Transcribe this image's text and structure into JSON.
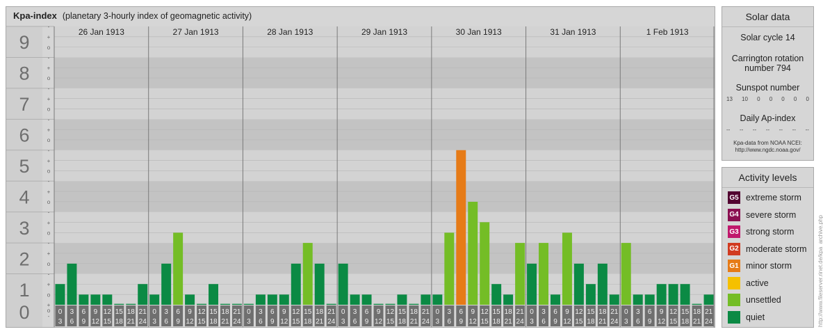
{
  "title": {
    "main": "Kpa-index",
    "sub": "(planetary 3-hourly index of geomagnetic activity)"
  },
  "chart_data": {
    "type": "bar",
    "title": "Kpa-index",
    "subtitle": "(planetary 3-hourly index of geomagnetic activity)",
    "ylim": [
      0,
      9
    ],
    "y_ticks": [
      "0",
      "1",
      "2",
      "3",
      "4",
      "5",
      "6",
      "7",
      "8",
      "9"
    ],
    "minor_marks": [
      "-",
      "o",
      "+"
    ],
    "days": [
      "26 Jan 1913",
      "27 Jan 1913",
      "28 Jan 1913",
      "29 Jan 1913",
      "30 Jan 1913",
      "31 Jan 1913",
      "1 Feb 1913"
    ],
    "interval_top": [
      "0",
      "3",
      "6",
      "9",
      "12",
      "15",
      "18",
      "21"
    ],
    "interval_bottom": [
      "3",
      "6",
      "9",
      "12",
      "15",
      "18",
      "21",
      "24"
    ],
    "values": [
      [
        0.67,
        1.33,
        0.33,
        0.33,
        0.33,
        0,
        0,
        0.67
      ],
      [
        0.33,
        1.33,
        2.33,
        0.33,
        0,
        0.67,
        0,
        0
      ],
      [
        0,
        0.33,
        0.33,
        0.33,
        1.33,
        2,
        1.33,
        0
      ],
      [
        1.33,
        0.33,
        0.33,
        0,
        0,
        0.33,
        0,
        0.33
      ],
      [
        0.33,
        2.33,
        5,
        3.33,
        2.67,
        0.67,
        0.33,
        2
      ],
      [
        1.33,
        2,
        0.33,
        2.33,
        1.33,
        0.67,
        1.33,
        0.33
      ],
      [
        2,
        0.33,
        0.33,
        0.67,
        0.67,
        0.67,
        0,
        0.33
      ]
    ],
    "colors": {
      "quiet": "#0b8a44",
      "unsettled": "#74bd26",
      "active": "#f5c000",
      "minor": "#e67b17"
    },
    "grid": true
  },
  "solar": {
    "heading": "Solar data",
    "cycle": "Solar cycle 14",
    "carrington_line1": "Carrington rotation",
    "carrington_line2": "number 794",
    "sunspot_heading": "Sunspot number",
    "sunspot_values": [
      "13",
      "10",
      "0",
      "0",
      "0",
      "0",
      "0"
    ],
    "ap_heading": "Daily Ap-index",
    "ap_values": [
      "--",
      "--",
      "--",
      "--",
      "--",
      "--",
      "--"
    ],
    "source_line1": "Kpa-data from NOAA NCEI:",
    "source_line2": "http://www.ngdc.noaa.gov/"
  },
  "activity": {
    "heading": "Activity levels",
    "levels": [
      {
        "code": "G5",
        "label": "extreme storm",
        "color": "#520230"
      },
      {
        "code": "G4",
        "label": "severe storm",
        "color": "#8a0f50"
      },
      {
        "code": "G3",
        "label": "strong storm",
        "color": "#c0186c"
      },
      {
        "code": "G2",
        "label": "moderate storm",
        "color": "#d13b20"
      },
      {
        "code": "G1",
        "label": "minor storm",
        "color": "#e67b17"
      },
      {
        "code": "",
        "label": "active",
        "color": "#f5c000"
      },
      {
        "code": "",
        "label": "unsettled",
        "color": "#74bd26"
      },
      {
        "code": "",
        "label": "quiet",
        "color": "#0b8a44"
      }
    ]
  },
  "credit": "http://www.fileserver.rinet.de/kpa_archive.php"
}
